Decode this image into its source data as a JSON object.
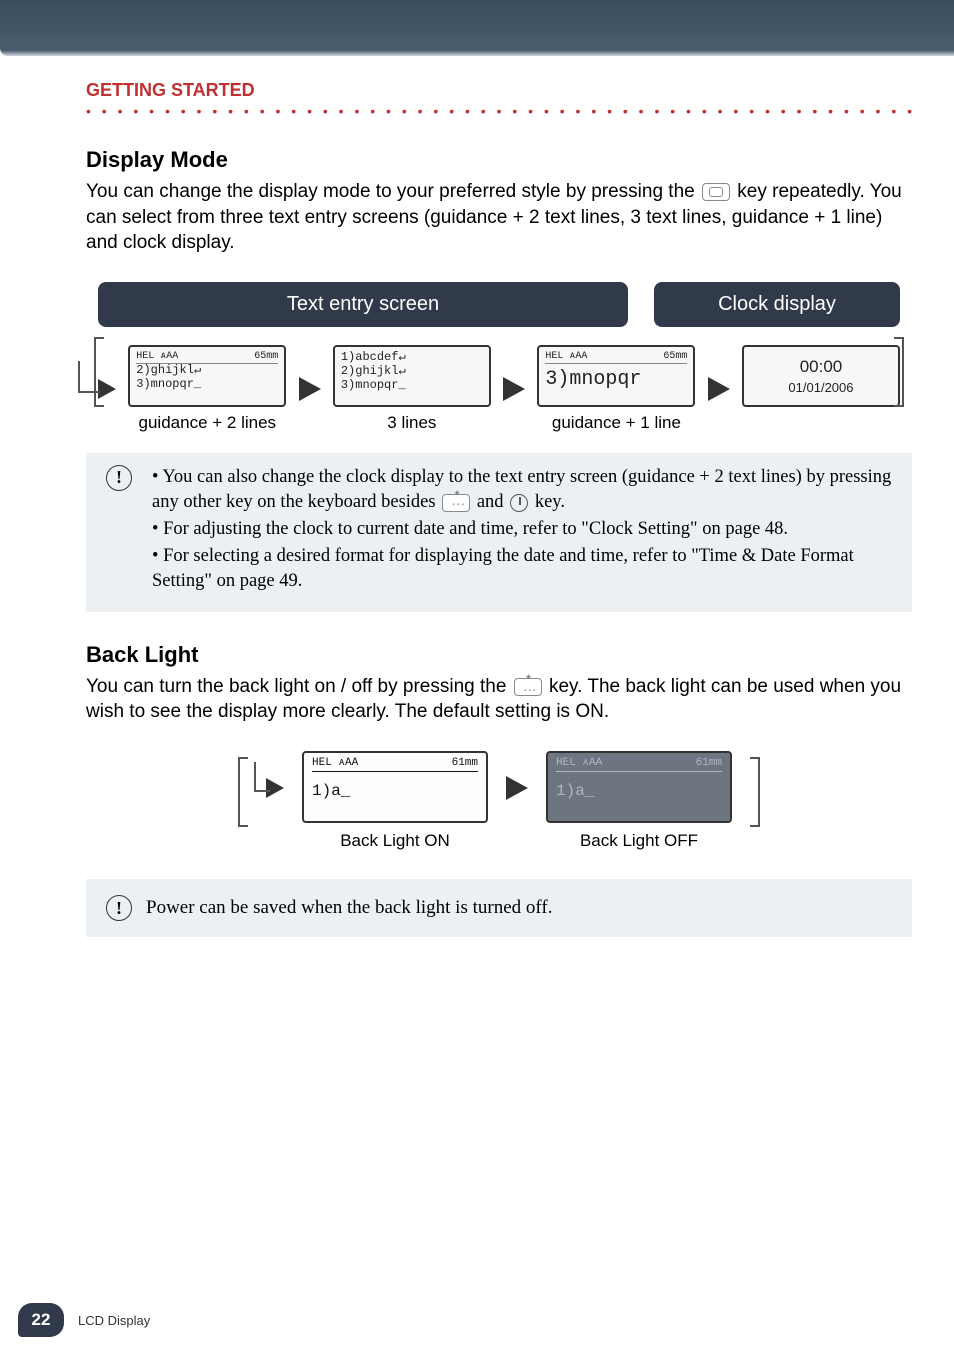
{
  "header": {
    "section": "GETTING STARTED"
  },
  "display_mode": {
    "heading": "Display Mode",
    "body_pre": "You can change the display mode to your preferred style by pressing the ",
    "body_post": " key repeatedly. You can select from three text entry screens (guidance + 2 text lines, 3 text lines, guidance + 1 line) and clock display.",
    "bar_text_entry": "Text entry screen",
    "bar_clock": "Clock display",
    "screens": {
      "s1": {
        "top_left": "HEL ᴀAA",
        "top_right": "65mm",
        "line2": "2)ghijkl↵",
        "line3": "3)mnopqr_",
        "caption": "guidance + 2 lines"
      },
      "s2": {
        "line1": "1)abcdef↵",
        "line2": "2)ghijkl↵",
        "line3": "3)mnopqr_",
        "caption": "3 lines"
      },
      "s3": {
        "top_left": "HEL ᴀAA",
        "top_right": "65mm",
        "big": "3)mnopqr",
        "caption": "guidance + 1 line"
      },
      "s4": {
        "time": "00:00",
        "date": "01/01/2006"
      }
    },
    "note1": "You can also change the clock display to the text entry screen (guidance + 2 text lines) by pressing any other key on the keyboard besides ",
    "note1_mid": " and ",
    "note1_end": " key.",
    "note2": "For adjusting the clock to current date and time, refer to \"Clock Setting\" on page 48.",
    "note3": "For selecting a desired format for displaying the date and time, refer to \"Time & Date Format Setting\" on page 49."
  },
  "back_light": {
    "heading": "Back Light",
    "body_pre": "You can turn the back light on / off by pressing the ",
    "body_post": " key. The back light can be used when you wish to see the display more clearly. The default setting is ON.",
    "on": {
      "top_left": "HEL ᴀAA",
      "top_right": "61mm",
      "line": "1)a_",
      "caption": "Back Light ON"
    },
    "off": {
      "top_left": "HEL ᴀAA",
      "top_right": "61mm",
      "line": "1)a_",
      "caption": "Back Light OFF"
    },
    "note": "Power can be saved when the back light is turned off."
  },
  "footer": {
    "page": "22",
    "title": "LCD Display"
  }
}
